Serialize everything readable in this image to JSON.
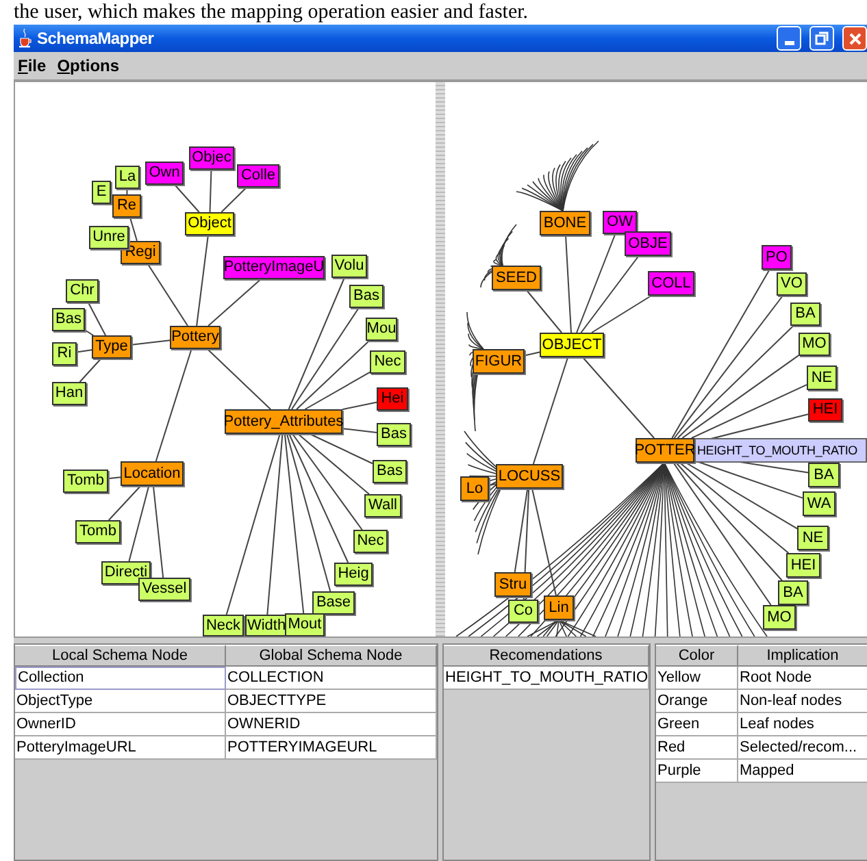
{
  "caption": "the user, which makes the mapping operation easier and faster.",
  "window": {
    "title": "SchemaMapper"
  },
  "menu": [
    "File",
    "Options"
  ],
  "local_graph": {
    "root": {
      "label": "Object",
      "kind": "root",
      "children": [
        {
          "label": "Objec",
          "kind": "mapped"
        },
        {
          "label": "Own",
          "kind": "mapped"
        },
        {
          "label": "Colle",
          "kind": "mapped"
        },
        {
          "label": "Pottery",
          "kind": "inner",
          "children": [
            {
              "label": "Regi",
              "kind": "inner",
              "children": [
                {
                  "label": "Re",
                  "kind": "inner",
                  "children": [
                    {
                      "label": "La",
                      "kind": "leaf"
                    },
                    {
                      "label": "E",
                      "kind": "leaf"
                    }
                  ]
                },
                {
                  "label": "Unre",
                  "kind": "leaf"
                }
              ]
            },
            {
              "label": "PotteryImageU",
              "kind": "mapped"
            },
            {
              "label": "Type",
              "kind": "inner",
              "children": [
                {
                  "label": "Chr",
                  "kind": "leaf"
                },
                {
                  "label": "Bas",
                  "kind": "leaf"
                },
                {
                  "label": "Ri",
                  "kind": "leaf"
                },
                {
                  "label": "Han",
                  "kind": "leaf"
                }
              ]
            },
            {
              "label": "Location",
              "kind": "inner",
              "children": [
                {
                  "label": "Tomb",
                  "kind": "leaf"
                },
                {
                  "label": "Tomb",
                  "kind": "leaf"
                },
                {
                  "label": "Directi",
                  "kind": "leaf"
                },
                {
                  "label": "Vessel",
                  "kind": "leaf"
                }
              ]
            },
            {
              "label": "Pottery_Attributes",
              "kind": "inner",
              "children": [
                {
                  "label": "Volu",
                  "kind": "leaf"
                },
                {
                  "label": "Bas",
                  "kind": "leaf"
                },
                {
                  "label": "Mou",
                  "kind": "leaf"
                },
                {
                  "label": "Nec",
                  "kind": "leaf"
                },
                {
                  "label": "Hei",
                  "kind": "selected"
                },
                {
                  "label": "Bas",
                  "kind": "leaf"
                },
                {
                  "label": "Bas",
                  "kind": "leaf"
                },
                {
                  "label": "Wall",
                  "kind": "leaf"
                },
                {
                  "label": "Nec",
                  "kind": "leaf"
                },
                {
                  "label": "Heig",
                  "kind": "leaf"
                },
                {
                  "label": "Base",
                  "kind": "leaf"
                },
                {
                  "label": "Neck",
                  "kind": "leaf"
                },
                {
                  "label": "Width",
                  "kind": "leaf"
                },
                {
                  "label": "Mout",
                  "kind": "leaf"
                }
              ]
            }
          ]
        }
      ]
    }
  },
  "global_graph": {
    "root": {
      "label": "OBJECT",
      "kind": "root",
      "children": [
        {
          "label": "BONE",
          "kind": "inner"
        },
        {
          "label": "OW",
          "kind": "mapped"
        },
        {
          "label": "OBJE",
          "kind": "mapped"
        },
        {
          "label": "SEED",
          "kind": "inner"
        },
        {
          "label": "COLL",
          "kind": "mapped"
        },
        {
          "label": "FIGUR",
          "kind": "inner"
        },
        {
          "label": "LOCUSS",
          "kind": "inner",
          "children": [
            {
              "label": "Lo",
              "kind": "inner"
            },
            {
              "label": "Stru",
              "kind": "inner"
            },
            {
              "label": "Co",
              "kind": "leaf"
            },
            {
              "label": "Lin",
              "kind": "inner"
            }
          ]
        },
        {
          "label": "POTTER",
          "kind": "inner",
          "children": [
            {
              "label": "PO",
              "kind": "mapped"
            },
            {
              "label": "VO",
              "kind": "leaf"
            },
            {
              "label": "BA",
              "kind": "leaf"
            },
            {
              "label": "MO",
              "kind": "leaf"
            },
            {
              "label": "NE",
              "kind": "leaf"
            },
            {
              "label": "HEI",
              "kind": "selected"
            },
            {
              "label": "BA",
              "kind": "leaf"
            },
            {
              "label": "WA",
              "kind": "leaf"
            },
            {
              "label": "NE",
              "kind": "leaf"
            },
            {
              "label": "HEI",
              "kind": "leaf"
            },
            {
              "label": "BA",
              "kind": "leaf"
            },
            {
              "label": "MO",
              "kind": "leaf"
            }
          ]
        }
      ]
    },
    "tooltip": "HEIGHT_TO_MOUTH_RATIO"
  },
  "mapping_table": {
    "columns": [
      "Local Schema Node",
      "Global Schema Node"
    ],
    "rows": [
      {
        "cells": [
          "Collection",
          "COLLECTION"
        ],
        "selected": true
      },
      {
        "cells": [
          "ObjectType",
          "OBJECTTYPE"
        ],
        "selected": false
      },
      {
        "cells": [
          "OwnerID",
          "OWNERID"
        ],
        "selected": false
      },
      {
        "cells": [
          "PotteryImageURL",
          "POTTERYIMAGEURL"
        ],
        "selected": false
      }
    ]
  },
  "recommendations_table": {
    "columns": [
      "Recomendations"
    ],
    "rows": [
      {
        "cells": [
          "HEIGHT_TO_MOUTH_RATIO"
        ],
        "selected": false
      }
    ]
  },
  "legend_table": {
    "columns": [
      "Color",
      "Implication"
    ],
    "rows": [
      {
        "cells": [
          "Yellow",
          "Root Node"
        ],
        "selected": false
      },
      {
        "cells": [
          "Orange",
          "Non-leaf nodes"
        ],
        "selected": false
      },
      {
        "cells": [
          "Green",
          "Leaf nodes"
        ],
        "selected": false
      },
      {
        "cells": [
          "Red",
          "Selected/recom..."
        ],
        "selected": false
      },
      {
        "cells": [
          "Purple",
          "Mapped"
        ],
        "selected": false
      }
    ]
  }
}
